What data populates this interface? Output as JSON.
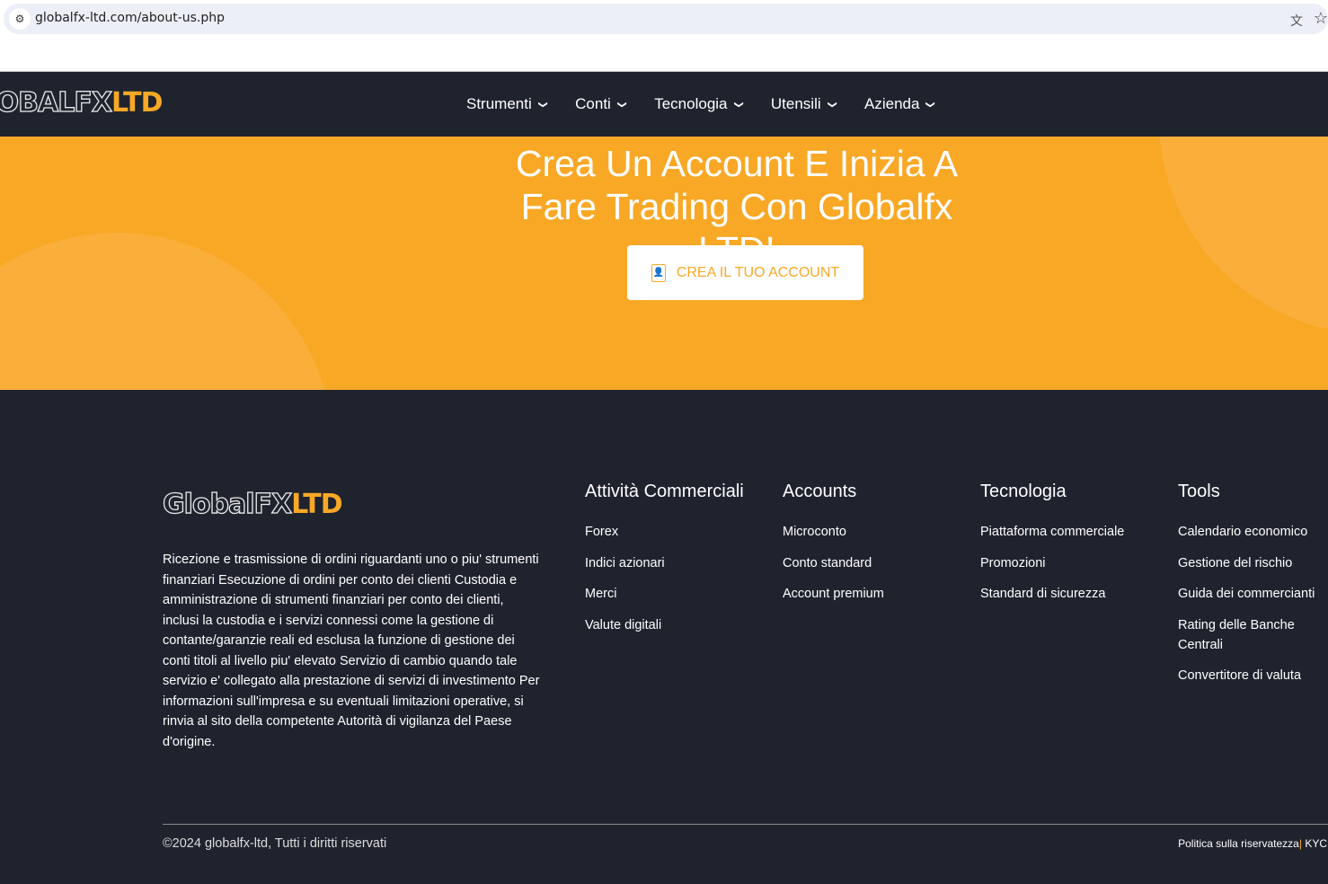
{
  "browser": {
    "url": "globalfx-ltd.com/about-us.php"
  },
  "logo": {
    "part1": "GLOBALFX",
    "part2": "LTD",
    "footer_part1": "GlobalFX",
    "footer_part2": "LTD"
  },
  "nav": [
    "Strumenti",
    "Conti",
    "Tecnologia",
    "Utensili",
    "Azienda"
  ],
  "hero": {
    "title": "Crea Un Account E Inizia A Fare Trading Con Globalfx LTD!",
    "cta": "CREA IL TUO ACCOUNT"
  },
  "footer": {
    "description": "Ricezione e trasmissione di ordini riguardanti uno o piu' strumenti finanziari Esecuzione di ordini per conto dei clienti Custodia e amministrazione di strumenti finanziari per conto dei clienti, inclusi la custodia e i servizi connessi come la gestione di contante/garanzie reali ed esclusa la funzione di gestione dei conti titoli al livello piu' elevato Servizio di cambio quando tale servizio e' collegato alla prestazione di servizi di investimento Per informazioni sull'impresa e su eventuali limitazioni operative, si rinvia al sito della competente Autorità di vigilanza del Paese d'origine.",
    "columns": [
      {
        "title": "Attività Commerciali",
        "links": [
          "Forex",
          "Indici azionari",
          "Merci",
          "Valute digitali"
        ]
      },
      {
        "title": "Accounts",
        "links": [
          "Microconto",
          "Conto standard",
          "Account premium"
        ]
      },
      {
        "title": "Tecnologia",
        "links": [
          "Piattaforma commerciale",
          "Promozioni",
          "Standard di sicurezza"
        ]
      },
      {
        "title": "Tools",
        "links": [
          "Calendario economico",
          "Gestione del rischio",
          "Guida dei commercianti",
          "Rating delle Banche Centrali",
          "Convertitore di valuta"
        ]
      }
    ],
    "copyright": "©2024 globalfx-ltd, Tutti i diritti riservati",
    "privacy": "Politica sulla riservatezza",
    "separator": "|",
    "kyc": "KYC"
  },
  "colors": {
    "accent": "#f9a826",
    "dark": "#1f232e"
  }
}
